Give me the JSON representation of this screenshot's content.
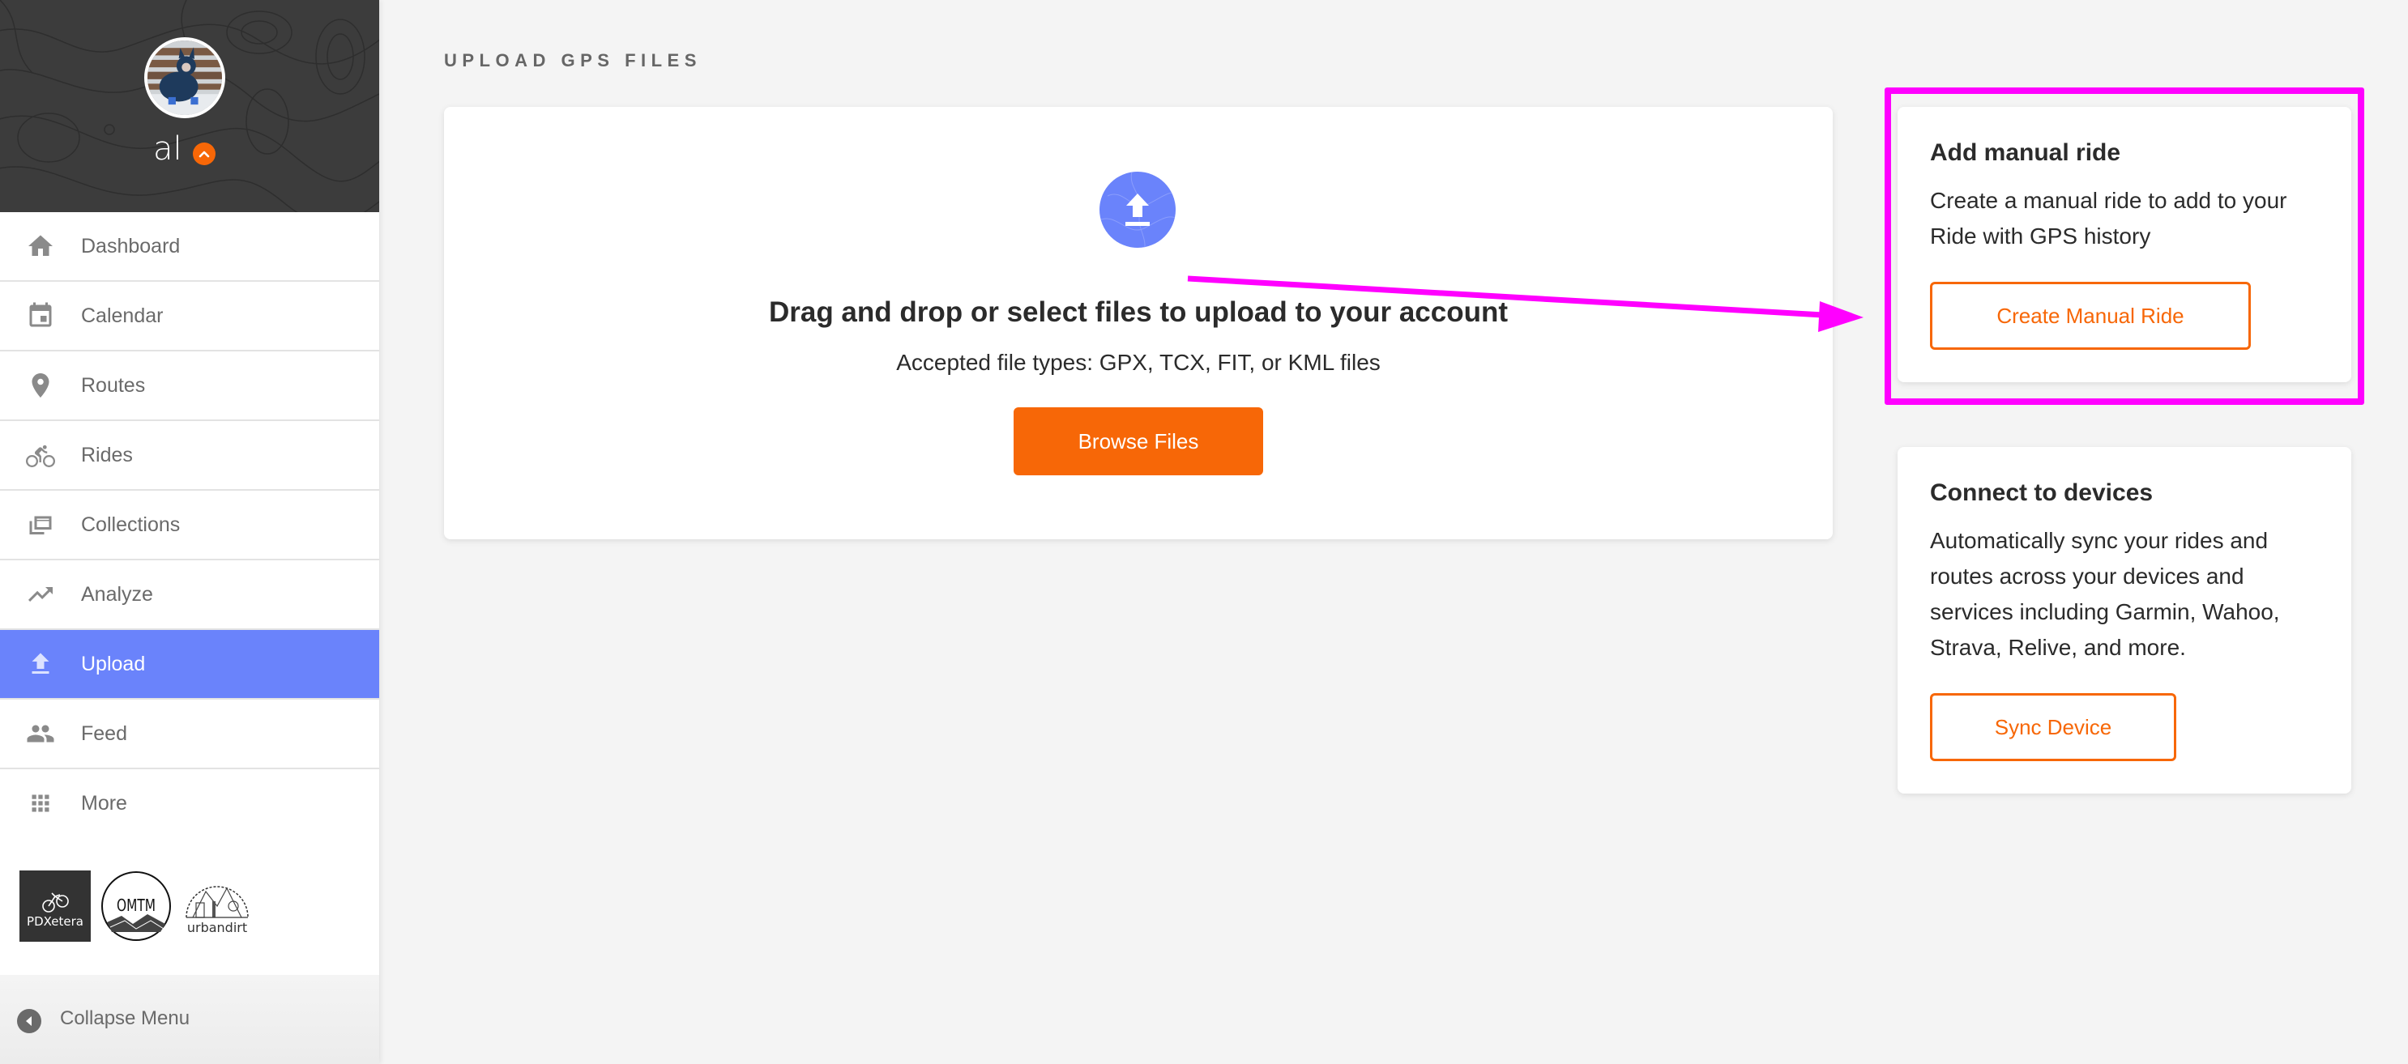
{
  "user": {
    "name": "al",
    "avatar_alt": "User avatar: dog in blue winter suit"
  },
  "sidebar": {
    "items": [
      {
        "label": "Dashboard",
        "icon": "home-icon",
        "active": false
      },
      {
        "label": "Calendar",
        "icon": "calendar-icon",
        "active": false
      },
      {
        "label": "Routes",
        "icon": "location-pin-icon",
        "active": false
      },
      {
        "label": "Rides",
        "icon": "cyclist-icon",
        "active": false
      },
      {
        "label": "Collections",
        "icon": "collections-icon",
        "active": false
      },
      {
        "label": "Analyze",
        "icon": "trending-up-icon",
        "active": false
      },
      {
        "label": "Upload",
        "icon": "upload-icon",
        "active": true
      },
      {
        "label": "Feed",
        "icon": "people-icon",
        "active": false
      },
      {
        "label": "More",
        "icon": "grid-icon",
        "active": false
      }
    ],
    "club_logos": [
      {
        "name": "PDXetera"
      },
      {
        "name": "OMTM"
      },
      {
        "name": "urbandirt"
      }
    ],
    "collapse_label": "Collapse Menu"
  },
  "main": {
    "page_title": "UPLOAD GPS FILES",
    "upload": {
      "heading": "Drag and drop or select files to upload to your account",
      "subtext": "Accepted file types: GPX, TCX, FIT, or KML files",
      "browse_button": "Browse Files"
    },
    "manual_ride": {
      "title": "Add manual ride",
      "text": "Create a manual ride to add to your Ride with GPS history",
      "button": "Create Manual Ride"
    },
    "devices": {
      "title": "Connect to devices",
      "text": "Automatically sync your rides and routes across your devices and services including Garmin, Wahoo, Strava, Relive, and more.",
      "button": "Sync Device"
    }
  },
  "colors": {
    "accent_orange": "#f76707",
    "active_blue": "#6a83fb",
    "annotation_magenta": "#ff00ff",
    "sidebar_header_bg": "#3c3c3c"
  }
}
